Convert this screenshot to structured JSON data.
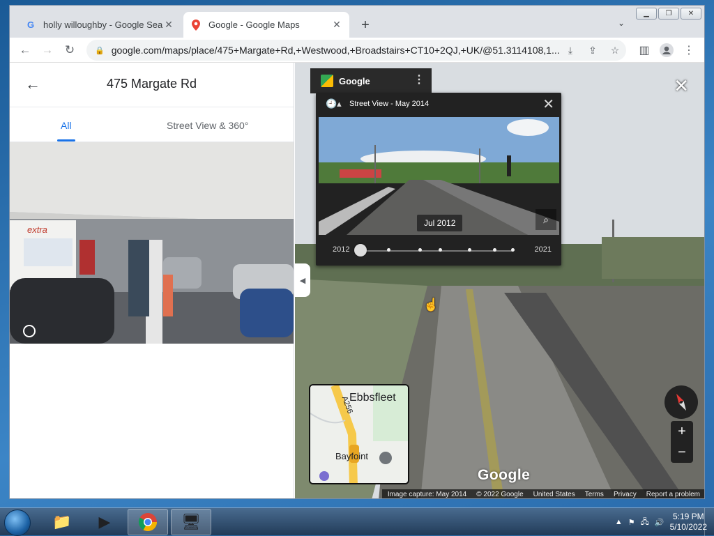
{
  "browser": {
    "tabs": [
      {
        "title": "holly willoughby - Google Search",
        "icon": "google-g-icon"
      },
      {
        "title": "Google - Google Maps",
        "icon": "maps-pin-icon"
      }
    ],
    "url": "google.com/maps/place/475+Margate+Rd,+Westwood,+Broadstairs+CT10+2QJ,+UK/@51.3114108,1...."
  },
  "panel": {
    "title": "475 Margate Rd",
    "tabs": [
      "All",
      "Street View & 360°"
    ]
  },
  "streetview": {
    "brand": "Google",
    "header": "Street View - May 2014",
    "thumb_date": "Jul 2012",
    "timeline_start": "2012",
    "timeline_end": "2021",
    "selected_point": 1,
    "points": 7
  },
  "minimap": {
    "place": "Ebbsfleet",
    "road": "A256",
    "area": "Bayfoint"
  },
  "map": {
    "logo": "Google",
    "footer": {
      "capture": "Image capture: May 2014",
      "copyright": "© 2022 Google",
      "region": "United States",
      "terms": "Terms",
      "privacy": "Privacy",
      "report": "Report a problem"
    }
  },
  "taskbar": {
    "time": "5:19 PM",
    "date": "5/10/2022"
  }
}
